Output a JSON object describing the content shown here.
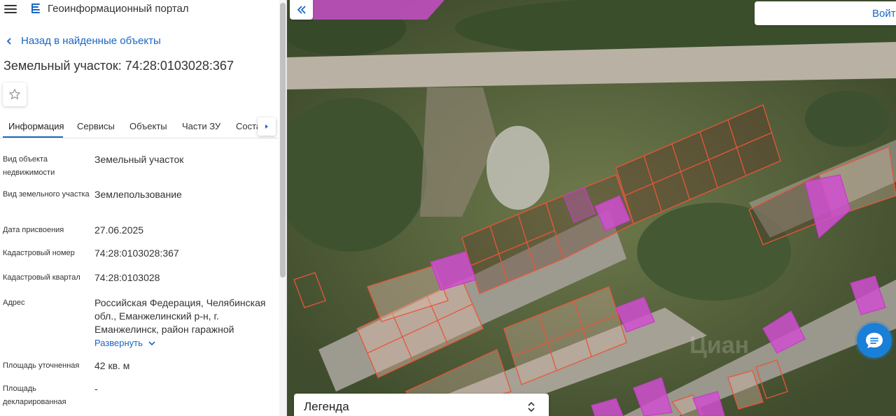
{
  "header": {
    "title": "Геоинформационный портал"
  },
  "nav": {
    "back_label": "Назад в найденные объекты"
  },
  "object": {
    "title": "Земельный участок: 74:28:0103028:367"
  },
  "tabs": [
    {
      "label": "Информация"
    },
    {
      "label": "Сервисы"
    },
    {
      "label": "Объекты"
    },
    {
      "label": "Части ЗУ"
    },
    {
      "label": "Соста"
    }
  ],
  "info": {
    "rows": [
      {
        "label": "Вид объекта недвижимости",
        "value": "Земельный участок"
      },
      {
        "label": "Вид земельного участка",
        "value": "Землепользование"
      },
      {
        "label": "Дата присвоения",
        "value": "27.06.2025"
      },
      {
        "label": "Кадастровый номер",
        "value": "74:28:0103028:367"
      },
      {
        "label": "Кадастровый квартал",
        "value": "74:28:0103028"
      },
      {
        "label": "Адрес",
        "value": "Российская Федерация, Челябинская обл., Еманжелинский р-н, г. Еманжелинск, район гаражной"
      },
      {
        "label": "Площадь уточненная",
        "value": "42 кв. м"
      },
      {
        "label": "Площадь декларированная",
        "value": "-"
      }
    ],
    "expand_label": "Развернуть"
  },
  "map": {
    "login_label": "Войти",
    "legend_label": "Легенда",
    "watermark": "Циан"
  },
  "colors": {
    "accent": "#1a66c2",
    "parcel_outline": "#e8553a",
    "parcel_highlight": "#d04fd0"
  },
  "icons": {
    "menu": "hamburger-icon",
    "logo": "portal-logo-icon",
    "back": "chevron-left-icon",
    "favorite": "star-outline-icon",
    "tabs_next": "caret-right-icon",
    "collapse": "double-chevron-left-icon",
    "expand": "chevron-down-icon",
    "legend_toggle": "chevron-up-down-icon",
    "chat": "chat-bubble-icon"
  }
}
